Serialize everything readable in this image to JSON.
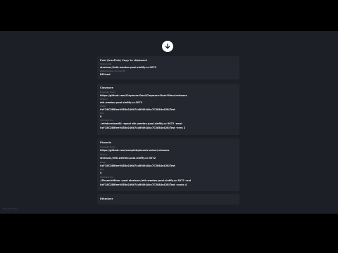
{
  "download_button": {
    "icon": "download-arrow-icon"
  },
  "card_pool": {
    "title": "Pool (IronFish) Copy to clipboard",
    "fields": [
      {
        "label": "Stratum URL",
        "value": "stratum://ieth.weeteu.pool.sinfify.cc:3072"
      },
      {
        "label": "Wallet address / Account ID",
        "value": "Bf1ixed"
      }
    ]
  },
  "card_claymore": {
    "title": "Claymore",
    "fields": [
      {
        "label": "Download binary",
        "value": "https://github.com/Claymore-Dual/Claymore-Dual-Miner/releases"
      },
      {
        "label": "Stratum",
        "value": "eth.weeteu.pool.sinfify.cc:3072"
      },
      {
        "label": "Wallet",
        "value": "0xF18C2B8fee945Be246b74cBf494Abc7C3884e42B/Test"
      },
      {
        "label": "Pool",
        "value": "8"
      },
      {
        "label": "Command line",
        "value": "./ethdcrminer64 -epool eth.weeteu.pool.sinfify.cc:3072 -ewal"
      },
      {
        "label": "",
        "value": "0xF18C2B8fee945Be246b74cBf494Abc7C3884e42B/Test -eres 2"
      }
    ]
  },
  "card_phoenix": {
    "title": "Phoenix",
    "fields": [
      {
        "label": "Download binary",
        "value": "https://github.com/completiphoenix-miner/releases"
      },
      {
        "label": "Stratum",
        "value": "stratum://eth.weeteu.pool.sinfify.cc:3072"
      },
      {
        "label": "Wallet",
        "value": "0xF18C2B8fee945Be246b74cBf494Abc7C3884e42B/Test"
      },
      {
        "label": "Pool",
        "value": "4"
      },
      {
        "label": "Command line",
        "value": "./PhoenixMiner -pool stratum://eth.weeteu.pool.sinfify.cc:3072 -wal"
      },
      {
        "label": "",
        "value": "0xF18C2B8fee945Be246b74cBf494Abc7C3884e42B/Test -proto 4"
      }
    ]
  },
  "card_ethminer": {
    "title": "Ethminer"
  },
  "watermark": "Made with InVideo"
}
